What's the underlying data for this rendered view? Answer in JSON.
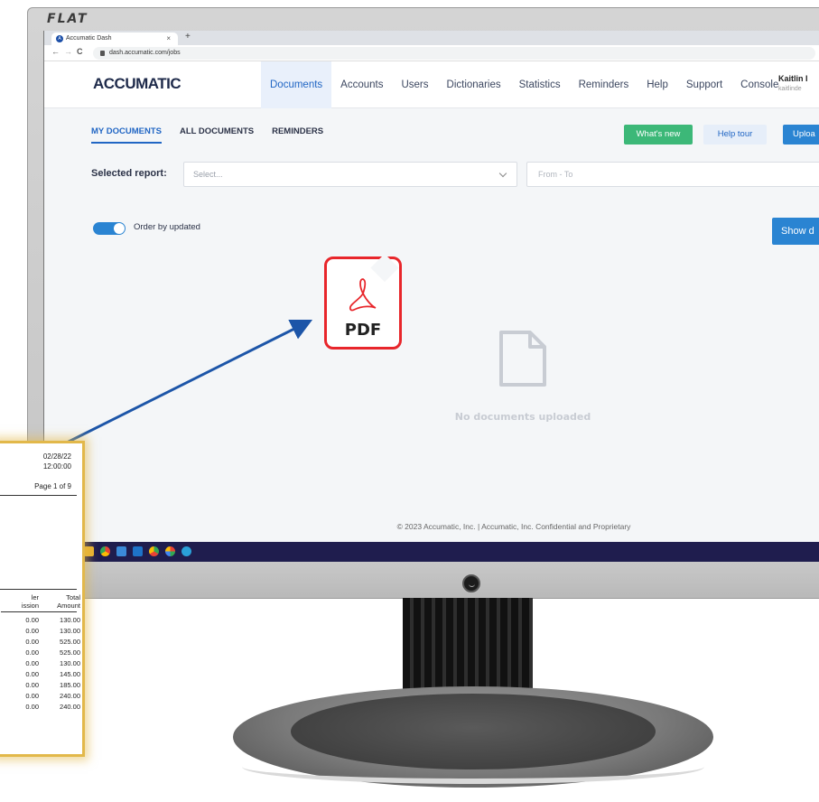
{
  "monitor": {
    "brand": "FLAT"
  },
  "browser": {
    "tab_title": "Accumatic Dash",
    "tab_close": "×",
    "new_tab": "+",
    "back": "←",
    "forward": "→",
    "reload": "C",
    "url": "dash.accumatic.com/jobs"
  },
  "app": {
    "logo": "ACCUMATIC",
    "nav": [
      {
        "label": "Documents",
        "active": true
      },
      {
        "label": "Accounts"
      },
      {
        "label": "Users"
      },
      {
        "label": "Dictionaries"
      },
      {
        "label": "Statistics"
      },
      {
        "label": "Reminders"
      },
      {
        "label": "Help"
      },
      {
        "label": "Support"
      },
      {
        "label": "Console"
      }
    ],
    "user": {
      "name": "Kaitlin I",
      "email": "kaitlinde"
    }
  },
  "documents": {
    "tabs": [
      "MY DOCUMENTS",
      "ALL DOCUMENTS",
      "REMINDERS"
    ],
    "whats_new": "What's new",
    "help_tour": "Help tour",
    "upload": "Uploa",
    "selected_report_label": "Selected report:",
    "select_placeholder": "Select...",
    "date_placeholder": "From - To",
    "show_button": "Show d",
    "toggle_label": "Order by updated",
    "toggle_on": true,
    "empty_message": "No documents uploaded",
    "footer": "© 2023 Accumatic, Inc. | Accumatic, Inc. Confidential and Proprietary"
  },
  "pdf_badge": {
    "label": "PDF"
  },
  "paper_report": {
    "date": "02/28/22",
    "time": "12:00:00",
    "page": "Page 1 of 9",
    "col1_line1": "ler",
    "col1_line2": "ission",
    "col2_line1": "Total",
    "col2_line2": "Amount",
    "rows": [
      [
        "0.00",
        "130.00"
      ],
      [
        "0.00",
        "130.00"
      ],
      [
        "0.00",
        "525.00"
      ],
      [
        "0.00",
        "525.00"
      ],
      [
        "0.00",
        "130.00"
      ],
      [
        "0.00",
        "145.00"
      ],
      [
        "0.00",
        "185.00"
      ],
      [
        "0.00",
        "240.00"
      ],
      [
        "0.00",
        "240.00"
      ]
    ]
  },
  "colors": {
    "accent": "#2166c4",
    "green": "#3cb878",
    "pdf_red": "#e8262b",
    "arrow": "#1c55a8",
    "paper_glow": "#e2b84a",
    "taskbar": "#1f1d4e"
  }
}
